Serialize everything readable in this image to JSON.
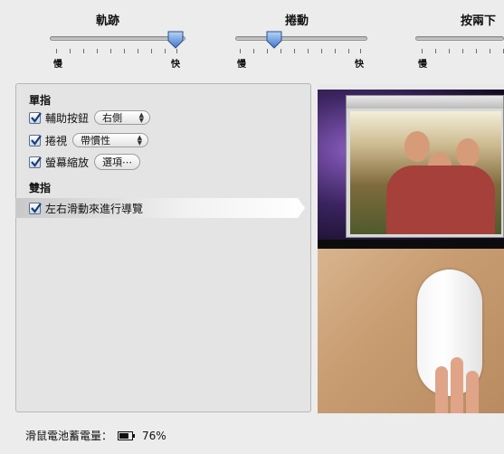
{
  "sliders": [
    {
      "title": "軌跡",
      "min_label": "慢",
      "max_label": "快",
      "value": 0.98
    },
    {
      "title": "捲動",
      "min_label": "慢",
      "max_label": "快",
      "value": 0.32
    },
    {
      "title": "按兩下",
      "min_label": "慢",
      "max_label": "",
      "value": null
    }
  ],
  "panel": {
    "single_finger": {
      "title": "單指",
      "options": [
        {
          "label": "輔助按鈕",
          "checked": true,
          "control": "popup",
          "control_value": "右側"
        },
        {
          "label": "捲視",
          "checked": true,
          "control": "popup",
          "control_value": "帶慣性"
        },
        {
          "label": "螢幕縮放",
          "checked": true,
          "control": "button",
          "control_value": "選項⋯"
        }
      ]
    },
    "two_finger": {
      "title": "雙指",
      "options": [
        {
          "label": "左右滑動來進行導覽",
          "checked": true,
          "selected": true
        }
      ]
    }
  },
  "battery": {
    "label": "滑鼠電池蓄電量：",
    "percent_text": "76%",
    "level": 0.76
  },
  "colors": {
    "window_bg": "#ececec",
    "panel_bg": "#e4e4e4",
    "checkbox_accent": "#1a3c78",
    "knob": "#5d8fd8"
  }
}
